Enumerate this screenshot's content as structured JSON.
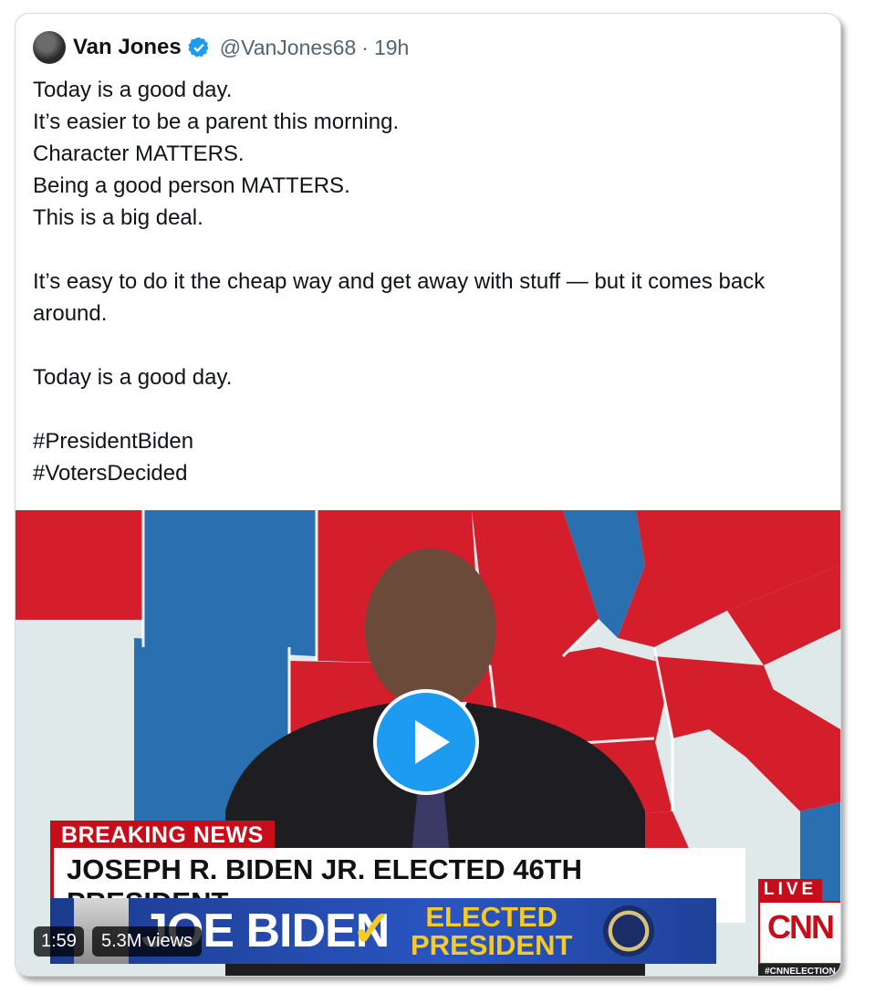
{
  "tweet": {
    "author_name": "Van Jones",
    "handle": "@VanJones68",
    "separator": "·",
    "time": "19h",
    "lines": [
      "Today is a good day.",
      "It’s easier to be a parent this morning.",
      "Character MATTERS.",
      "Being a good person MATTERS.",
      "This is a big deal.",
      "",
      "It’s easy to do it the cheap way and get away with stuff — but it comes back around.",
      "",
      "Today is a good day.",
      "",
      "#PresidentBiden",
      "#VotersDecided"
    ]
  },
  "video": {
    "breaking_label": "BREAKING NEWS",
    "headline": "JOSEPH R. BIDEN JR. ELECTED 46TH PRESIDENT",
    "ticker_name": "JOE BIDEN",
    "ticker_status_line1": "ELECTED",
    "ticker_status_line2": "PRESIDENT",
    "live_label": "LIVE",
    "network": "CNN",
    "hashtag": "#CNNELECTION",
    "duration": "1:59",
    "views": "5.3M views"
  },
  "colors": {
    "accent": "#1d9bf0",
    "cnn_red": "#c70d1a",
    "map_red": "#d41e2c",
    "map_blue": "#2a6fb0",
    "text_secondary": "#536471"
  }
}
